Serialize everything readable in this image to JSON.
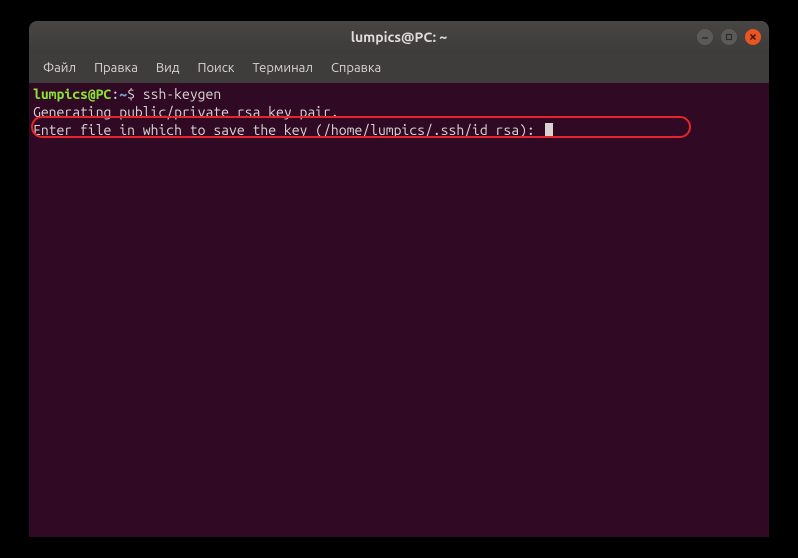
{
  "window": {
    "title": "lumpics@PC: ~"
  },
  "menubar": {
    "items": [
      "Файл",
      "Правка",
      "Вид",
      "Поиск",
      "Терминал",
      "Справка"
    ]
  },
  "terminal": {
    "prompt_user": "lumpics@PC",
    "prompt_sep": ":",
    "prompt_path": "~",
    "prompt_dollar": "$",
    "command": "ssh-keygen",
    "line2": "Generating public/private rsa key pair.",
    "line3": "Enter file in which to save the key (/home/lumpics/.ssh/id_rsa): "
  }
}
